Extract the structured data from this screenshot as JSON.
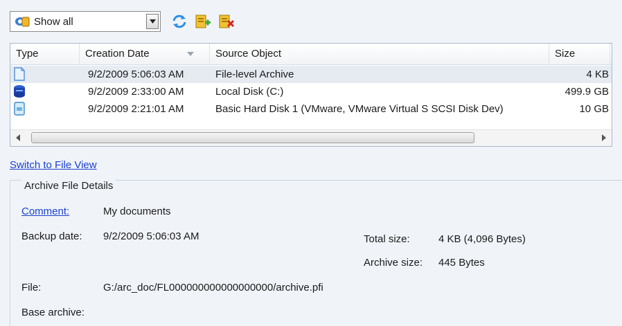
{
  "toolbar": {
    "filter_value": "Show all",
    "buttons": [
      {
        "icon": "refresh-icon"
      },
      {
        "icon": "add-archive-icon"
      },
      {
        "icon": "delete-archive-icon"
      }
    ]
  },
  "grid": {
    "columns": [
      "Type",
      "Creation Date",
      "Source Object",
      "Size"
    ],
    "rows": [
      {
        "icon": "file-archive-icon",
        "date": "9/2/2009 5:06:03 AM",
        "source": "File-level Archive",
        "size": "4 KB"
      },
      {
        "icon": "local-disk-icon",
        "date": "9/2/2009 2:33:00 AM",
        "source": "Local Disk (C:)",
        "size": "499.9 GB"
      },
      {
        "icon": "hard-disk-icon",
        "date": "9/2/2009 2:21:01 AM",
        "source": "Basic Hard Disk 1 (VMware, VMware Virtual S SCSI Disk Dev)",
        "size": "10 GB"
      }
    ]
  },
  "switch_link": "Switch to File View",
  "details": {
    "title": "Archive File Details",
    "comment_label": "Comment:",
    "comment_value": "My documents",
    "backup_date_label": "Backup date:",
    "backup_date_value": "9/2/2009 5:06:03 AM",
    "total_size_label": "Total size:",
    "total_size_value": "4 KB (4,096 Bytes)",
    "archive_size_label": "Archive size:",
    "archive_size_value": "445 Bytes",
    "file_label": "File:",
    "file_value": "G:/arc_doc/FL000000000000000000/archive.pfi",
    "base_archive_label": "Base archive:"
  }
}
